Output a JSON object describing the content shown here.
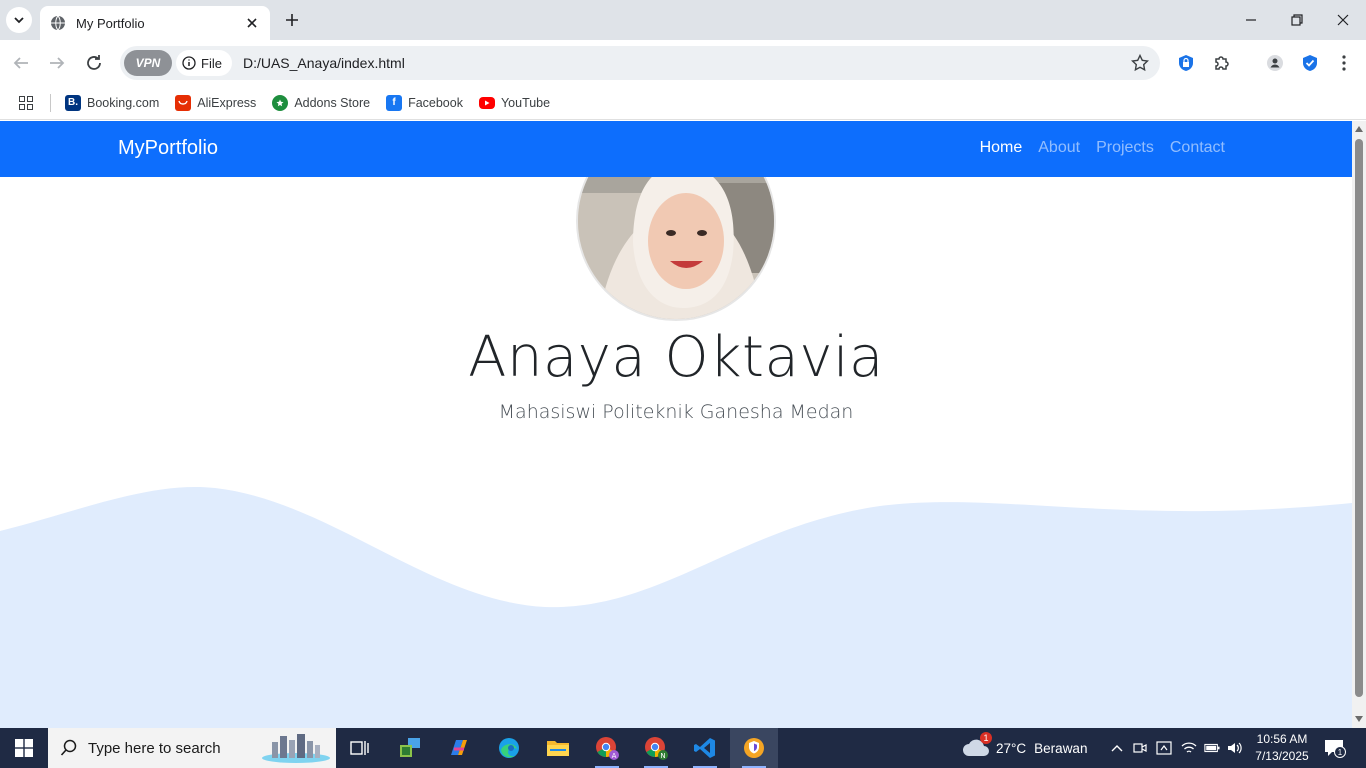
{
  "browser": {
    "tab_title": "My Portfolio",
    "url": "D:/UAS_Anaya/index.html",
    "security_chip": "File",
    "vpn_label": "VPN"
  },
  "bookmarks": [
    {
      "label": "Booking.com",
      "icon": "booking-icon",
      "color": "#003580",
      "glyph": "B."
    },
    {
      "label": "AliExpress",
      "icon": "aliexpress-icon",
      "color": "#e62e04",
      "glyph": ""
    },
    {
      "label": "Addons Store",
      "icon": "addons-store-icon",
      "color": "#1e8e3e",
      "glyph": ""
    },
    {
      "label": "Facebook",
      "icon": "facebook-icon",
      "color": "#1877f2",
      "glyph": "f"
    },
    {
      "label": "YouTube",
      "icon": "youtube-icon",
      "color": "#ff0000",
      "glyph": ""
    }
  ],
  "site": {
    "brand": "MyPortfolio",
    "nav": [
      {
        "label": "Home",
        "active": true
      },
      {
        "label": "About",
        "active": false
      },
      {
        "label": "Projects",
        "active": false
      },
      {
        "label": "Contact",
        "active": false
      }
    ],
    "hero": {
      "name": "Anaya Oktavia",
      "subtitle": "Mahasiswi Politeknik Ganesha Medan"
    },
    "colors": {
      "navbar": "#0d6efd",
      "wave": "#e0ecfd"
    }
  },
  "taskbar": {
    "search_placeholder": "Type here to search",
    "weather": {
      "temp": "27°C",
      "desc": "Berawan",
      "badge": "1"
    },
    "clock": {
      "time": "10:56 AM",
      "date": "7/13/2025"
    },
    "notification_count": "1"
  }
}
